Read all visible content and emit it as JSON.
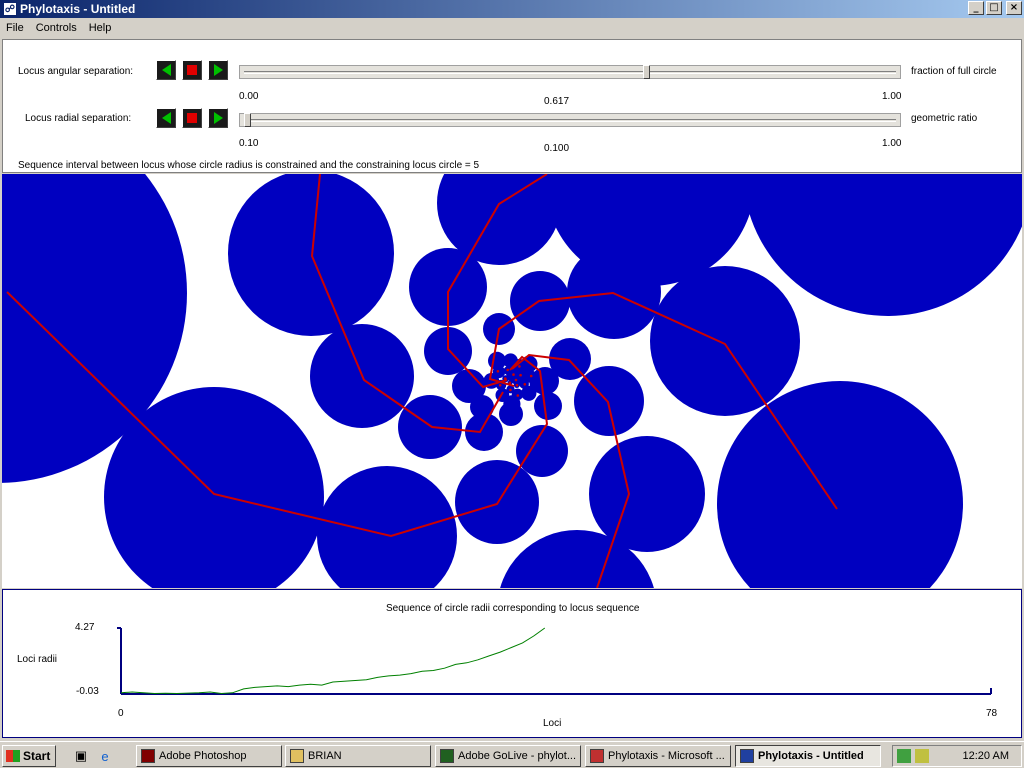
{
  "window": {
    "title": "Phylotaxis - Untitled",
    "min_symbol": "_",
    "max_symbol": "□",
    "close_symbol": "×"
  },
  "menu": [
    "File",
    "Controls",
    "Help"
  ],
  "controls": {
    "angular": {
      "label": "Locus angular separation:",
      "min": "0.00",
      "max": "1.00",
      "value": "0.617",
      "fraction": 0.617,
      "unit": "fraction of full circle"
    },
    "radial": {
      "label": "Locus radial separation:",
      "min": "0.10",
      "max": "1.00",
      "value": "0.100",
      "fraction": 0.0,
      "unit": "geometric ratio"
    },
    "sequence_text": "Sequence interval between locus whose circle radius is constrained and the constraining locus circle = 5"
  },
  "colors": {
    "circle": "#0000c0",
    "spiral": "#cc0000",
    "curve": "#008000",
    "axis": "#000080"
  },
  "graph": {
    "title": "Sequence of circle radii corresponding to locus sequence",
    "ylabel": "Loci radii",
    "xlabel": "Loci",
    "ymax_label": "4.27",
    "ymin_label": "-0.03",
    "xmin_label": "0",
    "xmax_label": "78"
  },
  "chart_data": {
    "type": "line",
    "title": "Sequence of circle radii corresponding to locus sequence",
    "xlabel": "Loci",
    "ylabel": "Loci radii",
    "xlim": [
      0,
      78
    ],
    "ylim": [
      -0.03,
      4.27
    ],
    "series": [
      {
        "x": [
          0,
          1,
          2,
          3,
          4,
          5,
          6,
          7,
          8,
          9,
          10,
          11,
          12,
          13,
          14,
          15,
          16,
          17,
          18,
          19,
          20,
          21,
          22,
          23,
          24,
          25,
          26,
          27,
          28,
          29,
          30,
          31,
          32,
          33,
          34,
          35,
          36,
          37,
          38
        ],
        "values": [
          0.05,
          0.1,
          0.05,
          0.0,
          0.02,
          0.0,
          0.03,
          0.05,
          0.1,
          0.0,
          0.05,
          0.3,
          0.4,
          0.45,
          0.5,
          0.45,
          0.55,
          0.6,
          0.55,
          0.75,
          0.8,
          0.85,
          0.9,
          1.05,
          1.15,
          1.2,
          1.3,
          1.45,
          1.5,
          1.65,
          1.9,
          2.0,
          2.2,
          2.45,
          2.7,
          3.0,
          3.3,
          3.75,
          4.27
        ]
      }
    ]
  },
  "taskbar": {
    "start": "Start",
    "tasks": [
      {
        "label": "Adobe Photoshop",
        "active": false,
        "color": "#800000"
      },
      {
        "label": "BRIAN",
        "active": false,
        "color": "#e0c060"
      },
      {
        "label": "Adobe GoLive - phylot...",
        "active": false,
        "color": "#206020"
      },
      {
        "label": "Phylotaxis - Microsoft ...",
        "active": false,
        "color": "#c03030"
      },
      {
        "label": "Phylotaxis - Untitled",
        "active": true,
        "color": "#2040a0"
      }
    ],
    "clock": "12:20 AM"
  }
}
